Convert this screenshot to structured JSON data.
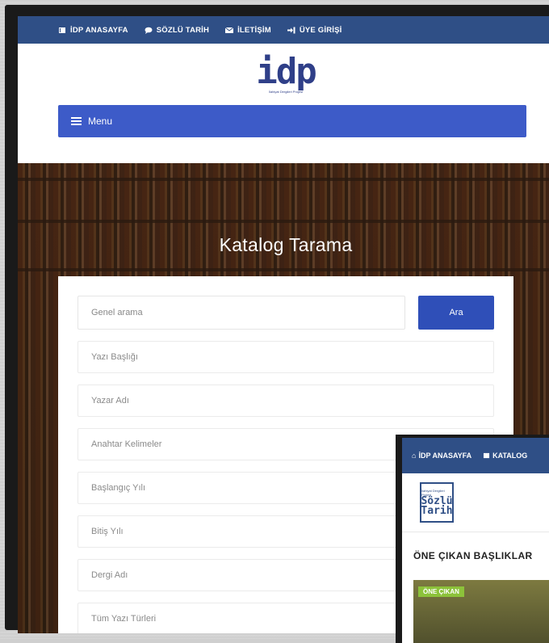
{
  "top_nav": {
    "items": [
      {
        "label": "İDP ANASAYFA",
        "icon": "book-icon"
      },
      {
        "label": "SÖZLÜ TARİH",
        "icon": "chat-icon"
      },
      {
        "label": "İLETİŞİM",
        "icon": "envelope-icon"
      },
      {
        "label": "ÜYE GİRİŞİ",
        "icon": "sign-in-icon"
      }
    ]
  },
  "logo": {
    "mark": "idp",
    "subtitle": "İlahiyat Dergileri Projesi"
  },
  "menu": {
    "label": "Menu"
  },
  "hero": {
    "title": "Katalog Tarama"
  },
  "search": {
    "general_placeholder": "Genel arama",
    "button_label": "Ara",
    "fields": [
      "Yazı Başlığı",
      "Yazar Adı",
      "Anahtar Kelimeler",
      "Başlangıç Yılı",
      "Bitiş Yılı",
      "Dergi Adı",
      "Tüm Yazı Türleri"
    ]
  },
  "overlay": {
    "nav": [
      {
        "label": "İDP ANASAYFA",
        "icon": "home-icon"
      },
      {
        "label": "KATALOG",
        "icon": "book-icon"
      }
    ],
    "logo_top": "İlahiyat Dergileri Projesi",
    "logo_text": "Sözlü Tarih",
    "heading": "ÖNE ÇIKAN BAŞLIKLAR",
    "badge": "ÖNE ÇIKAN"
  },
  "colors": {
    "nav": "#2f4f86",
    "menu": "#3d5bc8",
    "button": "#2f4fb8",
    "badge": "#8cc23a"
  }
}
